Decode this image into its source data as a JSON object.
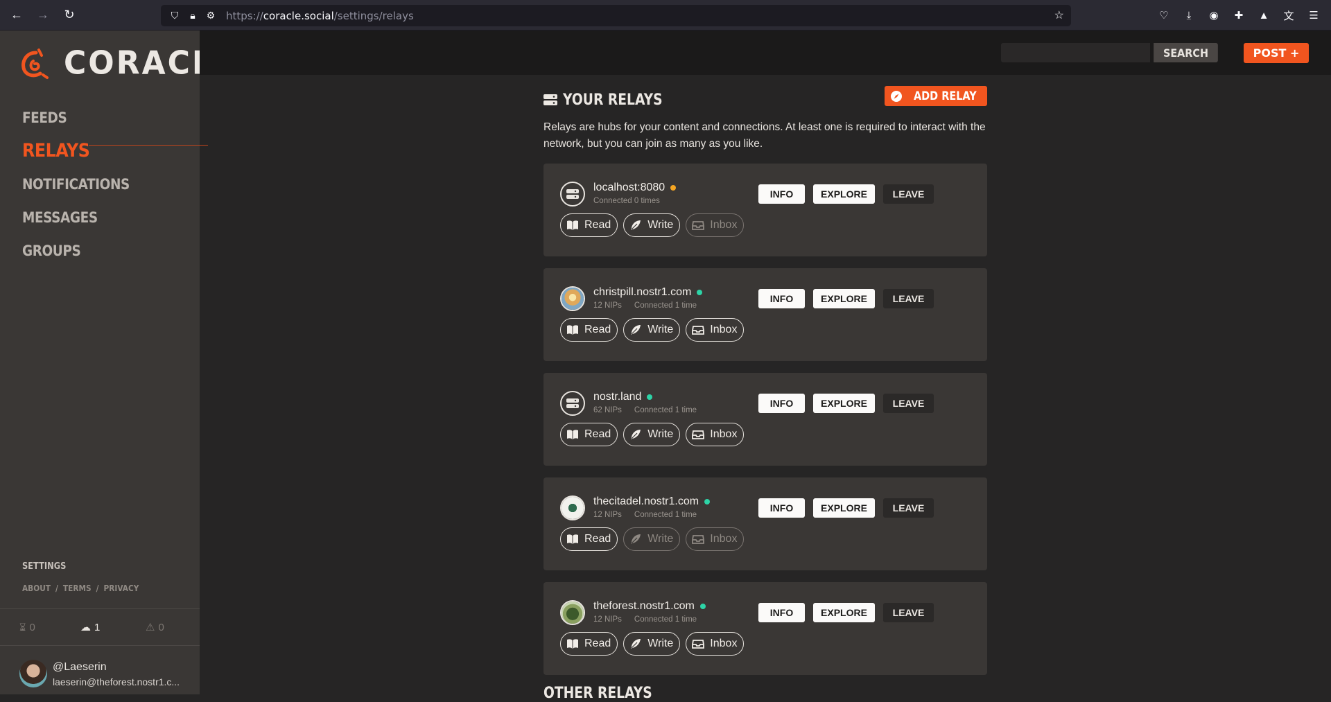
{
  "browser": {
    "url_prefix": "https://",
    "url_domain": "coracle.social",
    "url_path": "/settings/relays"
  },
  "sidebar": {
    "logo_text": "CORACLE",
    "nav": [
      {
        "label": "FEEDS"
      },
      {
        "label": "RELAYS"
      },
      {
        "label": "NOTIFICATIONS"
      },
      {
        "label": "MESSAGES"
      },
      {
        "label": "GROUPS"
      }
    ],
    "settings_label": "SETTINGS",
    "links": [
      "ABOUT",
      "/",
      "TERMS",
      "/",
      "PRIVACY"
    ],
    "status": {
      "pending": "0",
      "published": "1",
      "failed": "0"
    },
    "user": {
      "handle": "@Laeserin",
      "nip05": "laeserin@theforest.nostr1.c..."
    }
  },
  "topbar": {
    "search_label": "SEARCH",
    "post_label": "POST +"
  },
  "relays_section": {
    "title": "YOUR RELAYS",
    "add_label": "ADD RELAY",
    "intro": "Relays are hubs for your content and connections. At least one is required to interact with the network, but you can join as many as you like."
  },
  "relays": [
    {
      "name": "localhost:8080",
      "status_color": "#f5a623",
      "nips": "",
      "connected": "Connected 0 times",
      "perms": {
        "read": true,
        "write": true,
        "inbox": false
      }
    },
    {
      "name": "christpill.nostr1.com",
      "status_color": "#2dd4a7",
      "nips": "12 NIPs",
      "connected": "Connected 1 time",
      "perms": {
        "read": true,
        "write": true,
        "inbox": true
      }
    },
    {
      "name": "nostr.land",
      "status_color": "#2dd4a7",
      "nips": "62 NIPs",
      "connected": "Connected 1 time",
      "perms": {
        "read": true,
        "write": true,
        "inbox": true
      }
    },
    {
      "name": "thecitadel.nostr1.com",
      "status_color": "#2dd4a7",
      "nips": "12 NIPs",
      "connected": "Connected 1 time",
      "perms": {
        "read": true,
        "write": false,
        "inbox": false
      }
    },
    {
      "name": "theforest.nostr1.com",
      "status_color": "#2dd4a7",
      "nips": "12 NIPs",
      "connected": "Connected 1 time",
      "perms": {
        "read": true,
        "write": true,
        "inbox": true
      }
    }
  ],
  "perm_labels": {
    "read": "Read",
    "write": "Write",
    "inbox": "Inbox"
  },
  "action_labels": {
    "info": "INFO",
    "explore": "EXPLORE",
    "leave": "LEAVE"
  },
  "other_section": {
    "title": "OTHER RELAYS"
  },
  "colors": {
    "accent": "#f1551f",
    "online": "#2dd4a7",
    "pending": "#f5a623"
  }
}
